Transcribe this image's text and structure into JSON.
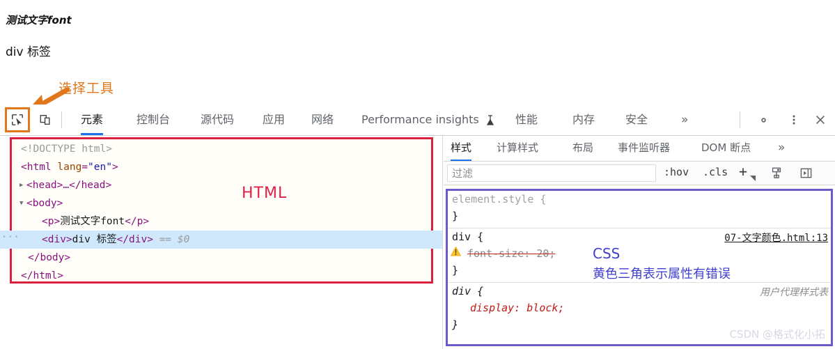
{
  "preview": {
    "paragraph_text": "测试文字font",
    "div_text": "div 标签"
  },
  "annotations": {
    "select_tool_label": "选择工具",
    "html_label": "HTML",
    "css_label": "CSS",
    "css_warning_note": "黄色三角表示属性有错误",
    "watermark": "CSDN @格式化小拓",
    "orange_color": "#e2761b",
    "red_color": "#d8213f",
    "purple_color": "#6a5acd",
    "annotation_blue": "#3f3fcf"
  },
  "toolbar": {
    "inspect_icon": "inspect-cursor-icon",
    "device_icon": "device-toolbar-icon",
    "tabs": [
      {
        "label": "元素",
        "active": true
      },
      {
        "label": "控制台",
        "active": false
      },
      {
        "label": "源代码",
        "active": false
      },
      {
        "label": "应用",
        "active": false
      },
      {
        "label": "网络",
        "active": false
      },
      {
        "label": "Performance insights",
        "active": false
      },
      {
        "label": "性能",
        "active": false
      },
      {
        "label": "内存",
        "active": false
      },
      {
        "label": "安全",
        "active": false
      }
    ],
    "overflow_label": "»",
    "settings_icon": "gear-icon",
    "more_icon": "kebab-menu-icon",
    "close_icon": "close-icon"
  },
  "dom_tree": {
    "lines": {
      "doctype": "<!DOCTYPE html>",
      "html_open_pre": "<",
      "html_tag": "html",
      "html_attr_name": "lang",
      "html_attr_value": "\"en\"",
      "head_collapsed": "<head>…</head>",
      "body_open": "<body>",
      "p_line_open": "<p>",
      "p_line_text": "测试文字font",
      "p_line_close": "</p>",
      "div_line_open": "<div>",
      "div_line_text": "div 标签",
      "div_line_close": "</div>",
      "div_line_ref": "== $0",
      "body_close": "</body>",
      "html_close": "</html>"
    }
  },
  "styles_panel": {
    "tabs": [
      {
        "label": "样式",
        "active": true
      },
      {
        "label": "计算样式",
        "active": false
      },
      {
        "label": "布局",
        "active": false
      },
      {
        "label": "事件监听器",
        "active": false
      },
      {
        "label": "DOM 断点",
        "active": false
      }
    ],
    "overflow_label": "»",
    "filter_placeholder": "过滤",
    "filter_value": "",
    "hov_button": ":hov",
    "cls_button": ".cls",
    "new_rule_button": "+",
    "print_icon": "print-styles-icon",
    "sidebar_toggle_icon": "collapse-sidebar-icon",
    "rules": [
      {
        "selector": "element.style {",
        "close": "}",
        "source": "",
        "declarations": []
      },
      {
        "selector": "div {",
        "close": "}",
        "source": "07-文字颜色.html:13",
        "declarations": [
          {
            "property": "font-size",
            "value": "20",
            "text": "font-size: 20;",
            "invalid": true,
            "warning_icon": "warning-triangle-icon"
          }
        ]
      },
      {
        "selector": "div {",
        "close": "}",
        "source": "用户代理样式表",
        "declarations": [
          {
            "property": "display",
            "value": "block",
            "text": "display: block;",
            "invalid": false
          }
        ]
      }
    ]
  }
}
